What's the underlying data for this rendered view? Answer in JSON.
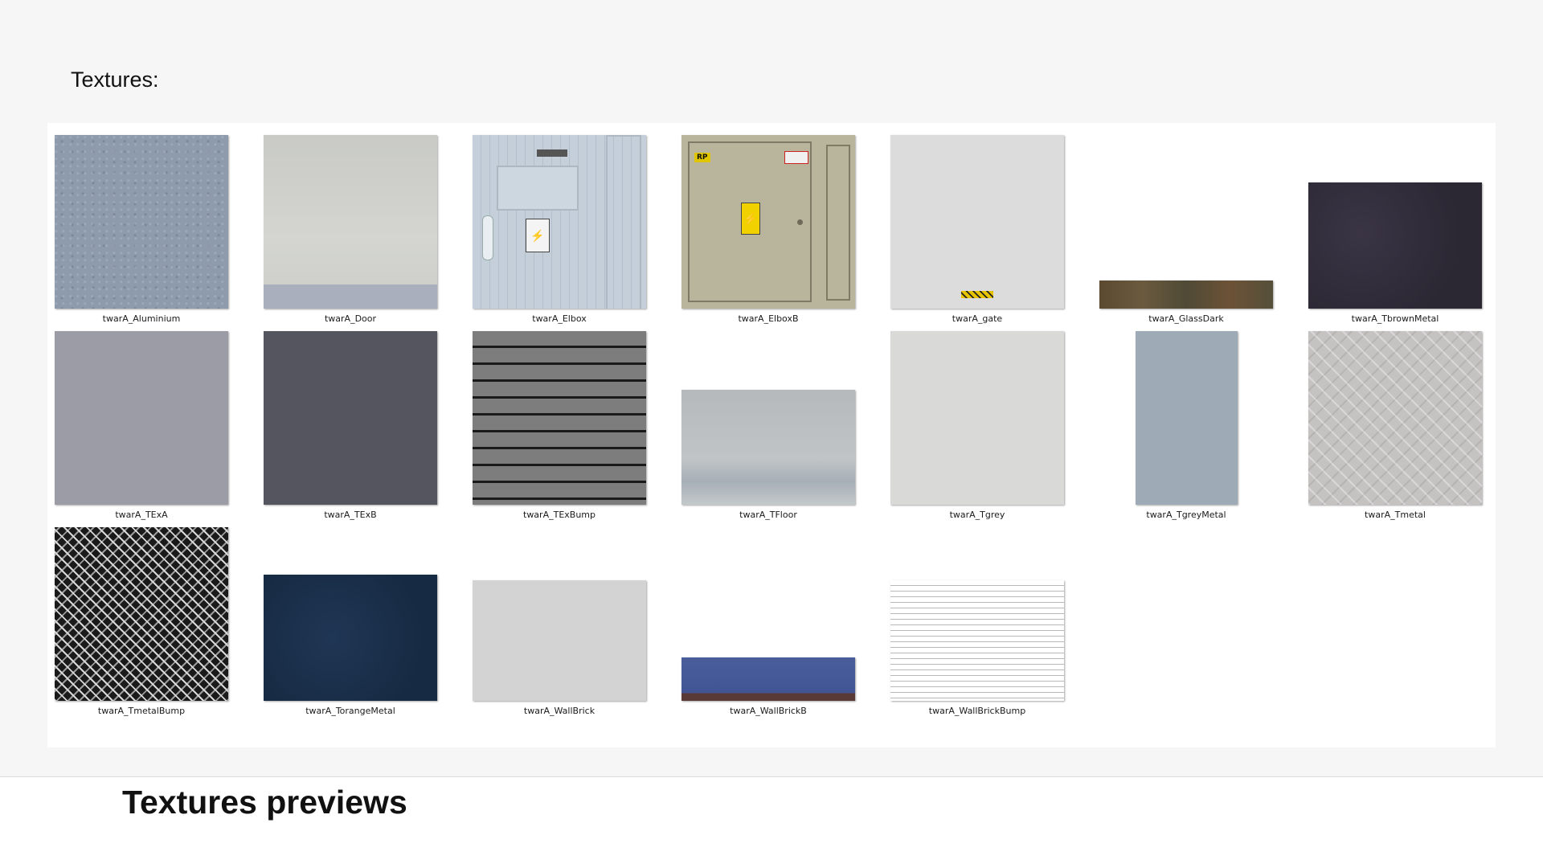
{
  "heading": "Textures:",
  "footer_title": "Textures previews",
  "textures": [
    {
      "name": "twarA_Aluminium"
    },
    {
      "name": "twarA_Door"
    },
    {
      "name": "twarA_Elbox"
    },
    {
      "name": "twarA_ElboxB"
    },
    {
      "name": "twarA_gate"
    },
    {
      "name": "twarA_GlassDark"
    },
    {
      "name": "twarA_TbrownMetal"
    },
    {
      "name": "twarA_TExA"
    },
    {
      "name": "twarA_TExB"
    },
    {
      "name": "twarA_TExBump"
    },
    {
      "name": "twarA_TFloor"
    },
    {
      "name": "twarA_Tgrey"
    },
    {
      "name": "twarA_TgreyMetal"
    },
    {
      "name": "twarA_Tmetal"
    },
    {
      "name": "twarA_TmetalBump"
    },
    {
      "name": "twarA_TorangeMetal"
    },
    {
      "name": "twarA_WallBrick"
    },
    {
      "name": "twarA_WallBrickB"
    },
    {
      "name": "twarA_WallBrickBump"
    }
  ],
  "elboxb_sign_text": "RP"
}
